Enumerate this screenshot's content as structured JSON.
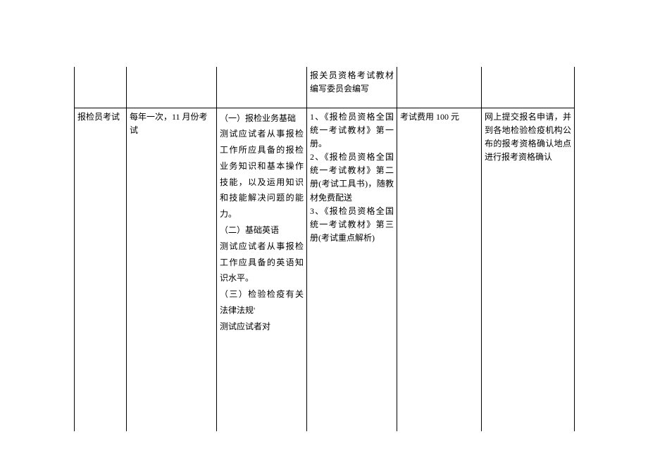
{
  "row1": {
    "c4": "报关员资格考试教材编写委员会编写"
  },
  "row2": {
    "c1": "报检员考试",
    "c2": "每年一次，11 月份考试",
    "c3": "（一）报检业务基础\n测试应试者从事报检工作所应具备的报检业务知识和基本操作技能，以及运用知识和技能解决问题的能力。\n（二）基础英语\n测试应试者从事报检工作应具备的英语知识水平。\n（三）检验检疫有关法律法规'\n测试应试者对",
    "c4": "1、《报检员资格全国统一考试教材》第一册。\n2、《报检员资格全国统一考试教材》第二册(考试工具书)，随教材免费配送\n3、《报检员资格全国统一考试教材》第三册(考试重点解析)",
    "c5": "考试费用 100 元",
    "c6": "网上提交报名申请，并到各地检验检疫机构公布的报考资格确认地点进行报考资格确认"
  }
}
